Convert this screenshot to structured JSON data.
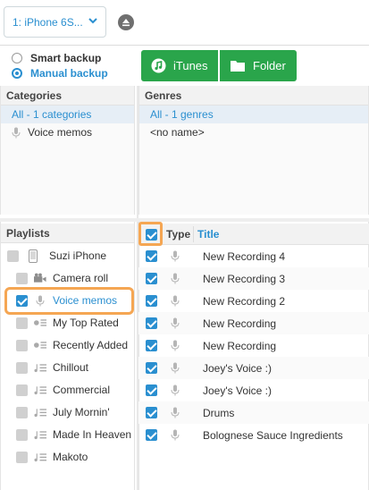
{
  "device": {
    "selected": "1: iPhone 6S..."
  },
  "backup": {
    "smart_label": "Smart backup",
    "manual_label": "Manual backup",
    "selected": "manual"
  },
  "actions": {
    "itunes_label": "iTunes",
    "folder_label": "Folder"
  },
  "categories": {
    "header": "Categories",
    "items": [
      {
        "label": "All - 1 categories",
        "selected": true
      },
      {
        "label": "Voice memos",
        "icon": "microphone-icon"
      }
    ]
  },
  "genres": {
    "header": "Genres",
    "items": [
      {
        "label": "All - 1 genres",
        "selected": true
      },
      {
        "label": "<no name>"
      }
    ]
  },
  "playlists": {
    "header": "Playlists",
    "items": [
      {
        "label": "Suzi iPhone",
        "icon": "phone-icon",
        "checked": false
      },
      {
        "label": "Camera roll",
        "icon": "camera-icon",
        "checked": false
      },
      {
        "label": "Voice memos",
        "icon": "microphone-icon",
        "checked": true,
        "active": true
      },
      {
        "label": "My Top Rated",
        "icon": "smart-playlist-icon",
        "checked": false
      },
      {
        "label": "Recently Added",
        "icon": "smart-playlist-icon",
        "checked": false
      },
      {
        "label": "Chillout",
        "icon": "playlist-icon",
        "checked": false
      },
      {
        "label": "Commercial",
        "icon": "playlist-icon",
        "checked": false
      },
      {
        "label": "July Mornin'",
        "icon": "playlist-icon",
        "checked": false
      },
      {
        "label": "Made In Heaven",
        "icon": "playlist-icon",
        "checked": false
      },
      {
        "label": "Makoto",
        "icon": "playlist-icon",
        "checked": false
      }
    ]
  },
  "tracks": {
    "columns": {
      "type": "Type",
      "title": "Title"
    },
    "all_checked": true,
    "rows": [
      {
        "title": "New Recording 4",
        "checked": true
      },
      {
        "title": "New Recording 3",
        "checked": true
      },
      {
        "title": "New Recording 2",
        "checked": true
      },
      {
        "title": "New Recording",
        "checked": true
      },
      {
        "title": "New Recording",
        "checked": true
      },
      {
        "title": "Joey's Voice :)",
        "checked": true
      },
      {
        "title": "Joey's Voice :)",
        "checked": true
      },
      {
        "title": "Drums",
        "checked": true
      },
      {
        "title": "Bolognese Sauce Ingredients",
        "checked": true
      }
    ]
  },
  "colors": {
    "accent": "#2a8fd0",
    "green": "#2aa54b",
    "highlight": "#f5a653"
  }
}
